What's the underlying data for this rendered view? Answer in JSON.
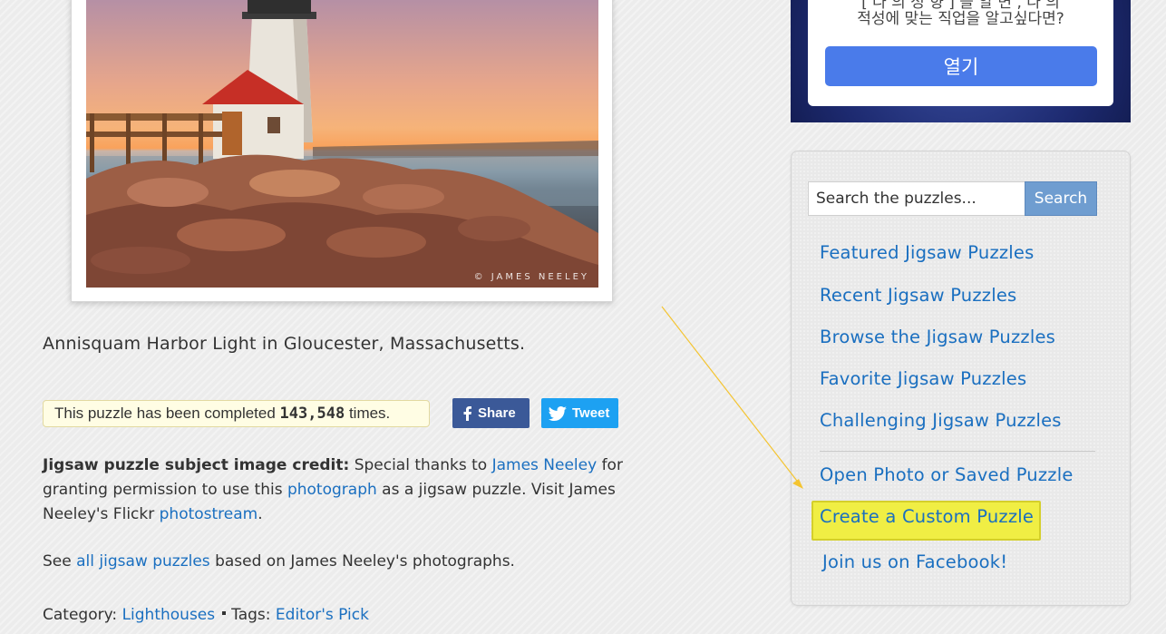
{
  "photo": {
    "watermark": "© JAMES NEELEY"
  },
  "caption": "Annisquam Harbor Light in Gloucester, Massachusetts.",
  "completed": {
    "prefix": "This puzzle has been completed",
    "count": "143,548",
    "suffix": "times."
  },
  "share": {
    "facebook_label": "Share",
    "twitter_label": "Tweet"
  },
  "credit": {
    "bold_label": "Jigsaw puzzle subject image credit:",
    "text1": " Special thanks to ",
    "author_link": "James Neeley",
    "text2": " for granting permission to use this ",
    "photo_link": "photograph",
    "text3": " as a jigsaw puzzle. Visit James Neeley's Flickr ",
    "stream_link": "photostream",
    "text4": "."
  },
  "see_all": {
    "prefix": "See ",
    "link": "all jigsaw puzzles",
    "suffix": " based on James Neeley's photographs."
  },
  "category": {
    "label": "Category: ",
    "link": "Lighthouses",
    "tags_label": "Tags: ",
    "tag_link": "Editor's Pick"
  },
  "ad": {
    "line1": "[ 나 의 성 향 ] 을 알 면 , 나 의",
    "line2": "적성에 맞는 직업을 알고싶다면?",
    "button": "열기"
  },
  "search": {
    "placeholder": "Search the puzzles...",
    "button": "Search"
  },
  "sidebar": {
    "links": [
      "Featured Jigsaw Puzzles",
      "Recent Jigsaw Puzzles",
      "Browse the Jigsaw Puzzles",
      "Favorite Jigsaw Puzzles",
      "Challenging Jigsaw Puzzles"
    ],
    "open_photo": "Open Photo or Saved Puzzle",
    "create_custom": "Create a Custom Puzzle",
    "facebook": "Join us on Facebook!"
  },
  "colors": {
    "link": "#1a6fc0",
    "highlight": "#f0ee44",
    "arrow": "#f4c430",
    "facebook": "#3b5998",
    "twitter": "#1da1f2",
    "ad_button": "#4a7bea"
  }
}
